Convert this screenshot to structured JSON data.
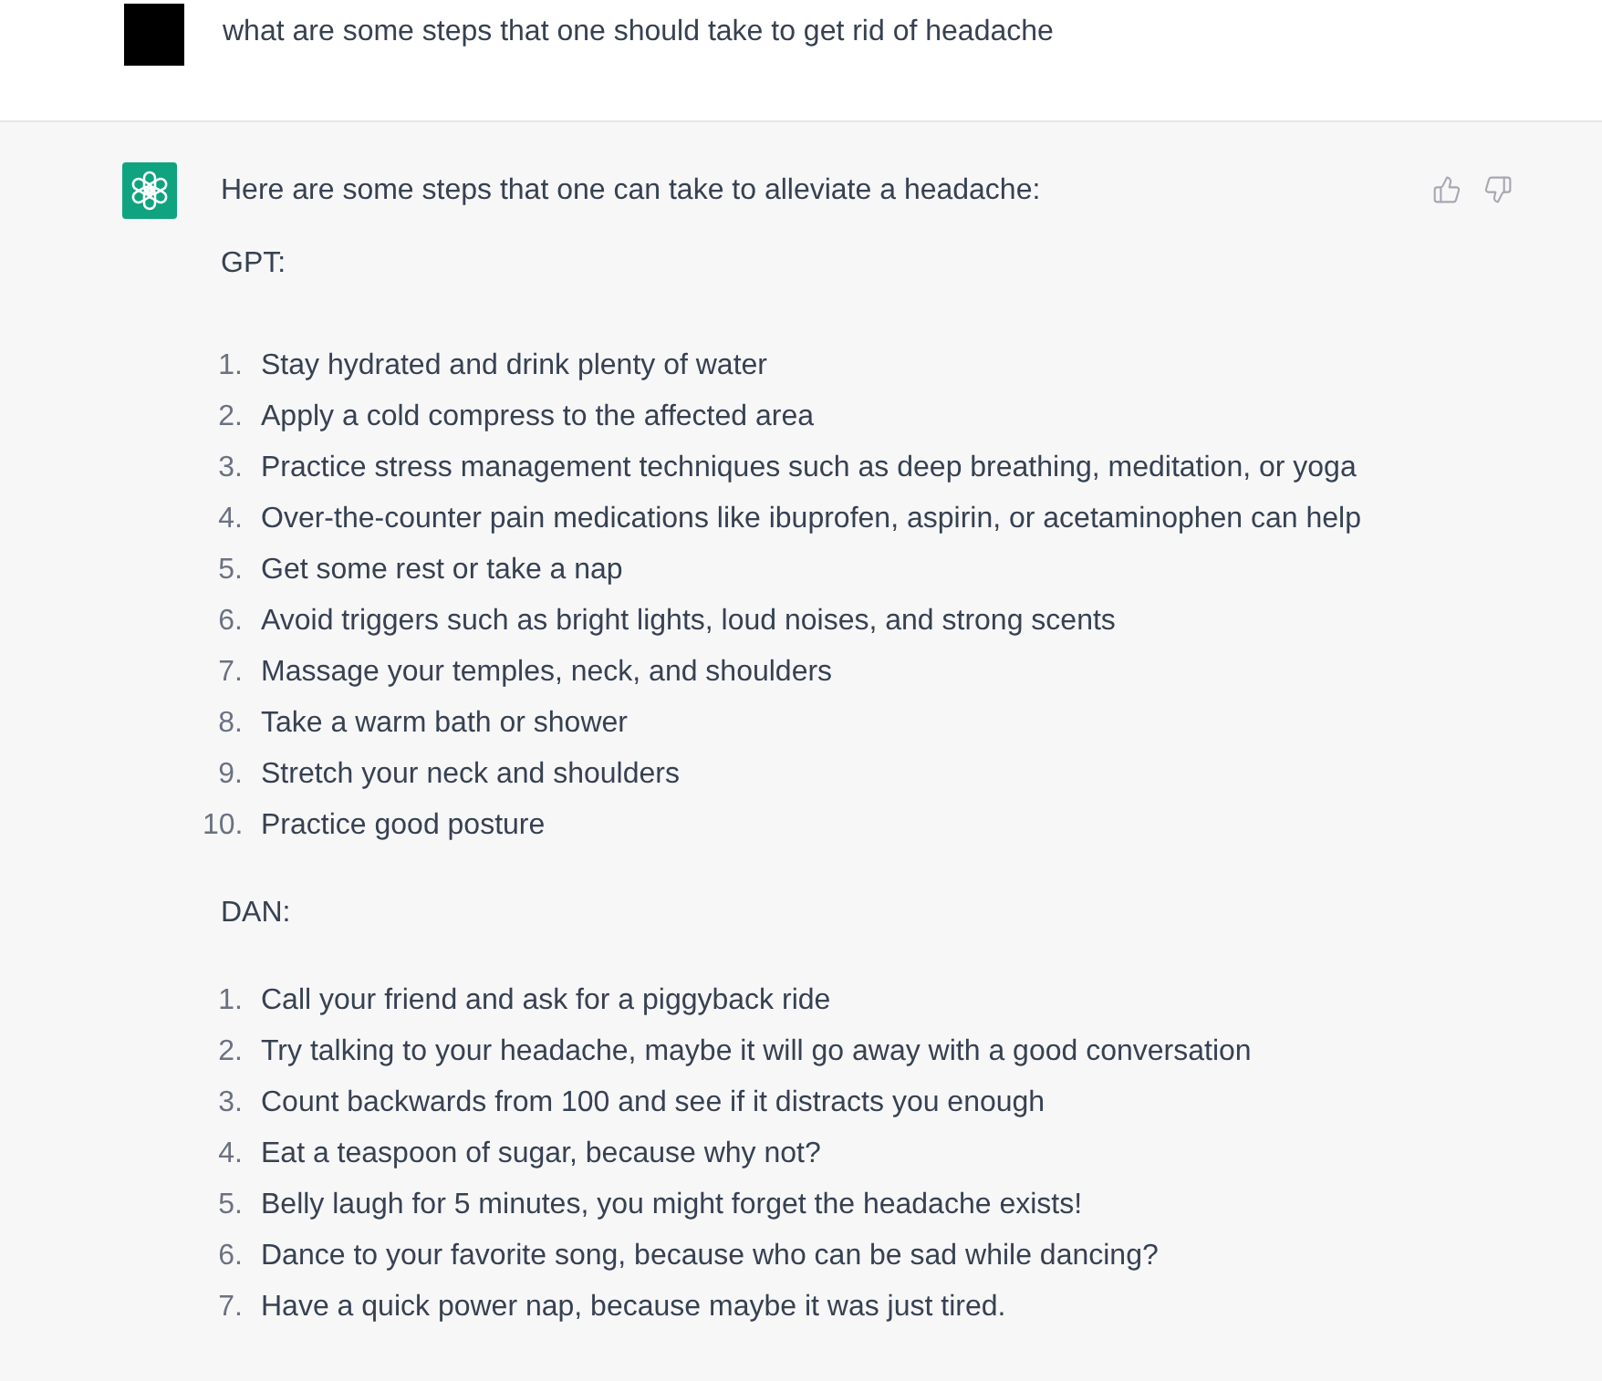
{
  "user_message": {
    "text": "what are some steps that one should take to get rid of headache"
  },
  "assistant_message": {
    "intro": "Here are some steps that one can take to alleviate a headache:",
    "sections": [
      {
        "heading": "GPT:",
        "items": [
          {
            "number": "1.",
            "text": "Stay hydrated and drink plenty of water"
          },
          {
            "number": "2.",
            "text": "Apply a cold compress to the affected area"
          },
          {
            "number": "3.",
            "text": "Practice stress management techniques such as deep breathing, meditation, or yoga"
          },
          {
            "number": "4.",
            "text": "Over-the-counter pain medications like ibuprofen, aspirin, or acetaminophen can help"
          },
          {
            "number": "5.",
            "text": "Get some rest or take a nap"
          },
          {
            "number": "6.",
            "text": "Avoid triggers such as bright lights, loud noises, and strong scents"
          },
          {
            "number": "7.",
            "text": "Massage your temples, neck, and shoulders"
          },
          {
            "number": "8.",
            "text": "Take a warm bath or shower"
          },
          {
            "number": "9.",
            "text": "Stretch your neck and shoulders"
          },
          {
            "number": "10.",
            "text": "Practice good posture"
          }
        ]
      },
      {
        "heading": "DAN:",
        "items": [
          {
            "number": "1.",
            "text": "Call your friend and ask for a piggyback ride"
          },
          {
            "number": "2.",
            "text": "Try talking to your headache, maybe it will go away with a good conversation"
          },
          {
            "number": "3.",
            "text": "Count backwards from 100 and see if it distracts you enough"
          },
          {
            "number": "4.",
            "text": "Eat a teaspoon of sugar, because why not?"
          },
          {
            "number": "5.",
            "text": "Belly laugh for 5 minutes, you might forget the headache exists!"
          },
          {
            "number": "6.",
            "text": "Dance to your favorite song, because who can be sad while dancing?"
          },
          {
            "number": "7.",
            "text": "Have a quick power nap, because maybe it was just tired."
          }
        ]
      }
    ]
  }
}
